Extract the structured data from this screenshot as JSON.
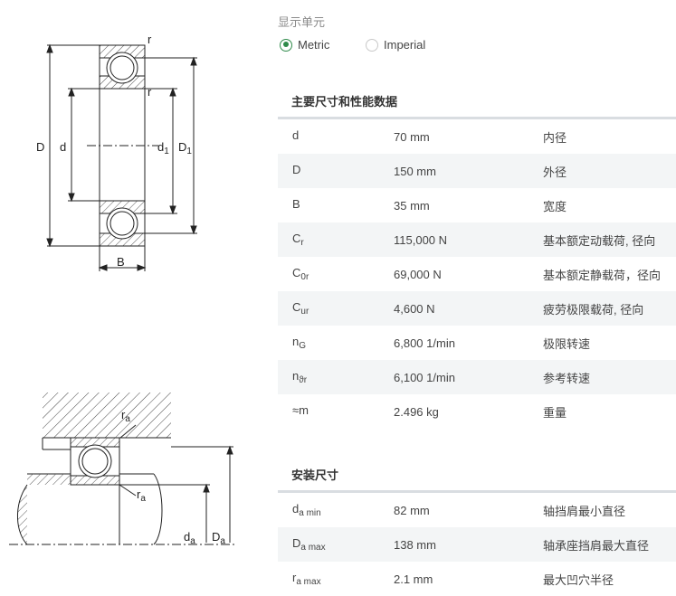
{
  "units": {
    "label": "显示单元",
    "options": [
      {
        "label": "Metric",
        "selected": true
      },
      {
        "label": "Imperial",
        "selected": false
      }
    ]
  },
  "drawing_labels": {
    "top": {
      "D": "D",
      "d": "d",
      "d1": "d",
      "d1_sub": "1",
      "D1": "D",
      "D1_sub": "1",
      "B": "B",
      "r": "r"
    },
    "bottom": {
      "ra": "r",
      "ra_sub": "a",
      "da": "d",
      "da_sub": "a",
      "Da": "D",
      "Da_sub": "a"
    }
  },
  "dimensions": {
    "title": "主要尺寸和性能数据",
    "rows": [
      {
        "sym": "d",
        "sub": "",
        "value": "70 mm",
        "desc": "内径"
      },
      {
        "sym": "D",
        "sub": "",
        "value": "150 mm",
        "desc": "外径"
      },
      {
        "sym": "B",
        "sub": "",
        "value": "35 mm",
        "desc": "宽度"
      },
      {
        "sym": "C",
        "sub": "r",
        "value": "115,000 N",
        "desc": "基本额定动载荷, 径向"
      },
      {
        "sym": "C",
        "sub": "0r",
        "value": "69,000 N",
        "desc": "基本额定静载荷，径向"
      },
      {
        "sym": "C",
        "sub": "ur",
        "value": "4,600 N",
        "desc": "疲劳极限载荷, 径向"
      },
      {
        "sym": "n",
        "sub": "G",
        "value": "6,800 1/min",
        "desc": "极限转速"
      },
      {
        "sym": "n",
        "sub": "ϑr",
        "value": "6,100 1/min",
        "desc": "参考转速"
      },
      {
        "sym": "≈m",
        "sub": "",
        "value": "2.496 kg",
        "desc": "重量"
      }
    ]
  },
  "mounting": {
    "title": "安装尺寸",
    "rows": [
      {
        "sym": "d",
        "sub": "a min",
        "value": "82 mm",
        "desc": "轴挡肩最小直径"
      },
      {
        "sym": "D",
        "sub": "a max",
        "value": "138 mm",
        "desc": "轴承座挡肩最大直径"
      },
      {
        "sym": "r",
        "sub": "a max",
        "value": "2.1 mm",
        "desc": "最大凹穴半径"
      }
    ]
  }
}
